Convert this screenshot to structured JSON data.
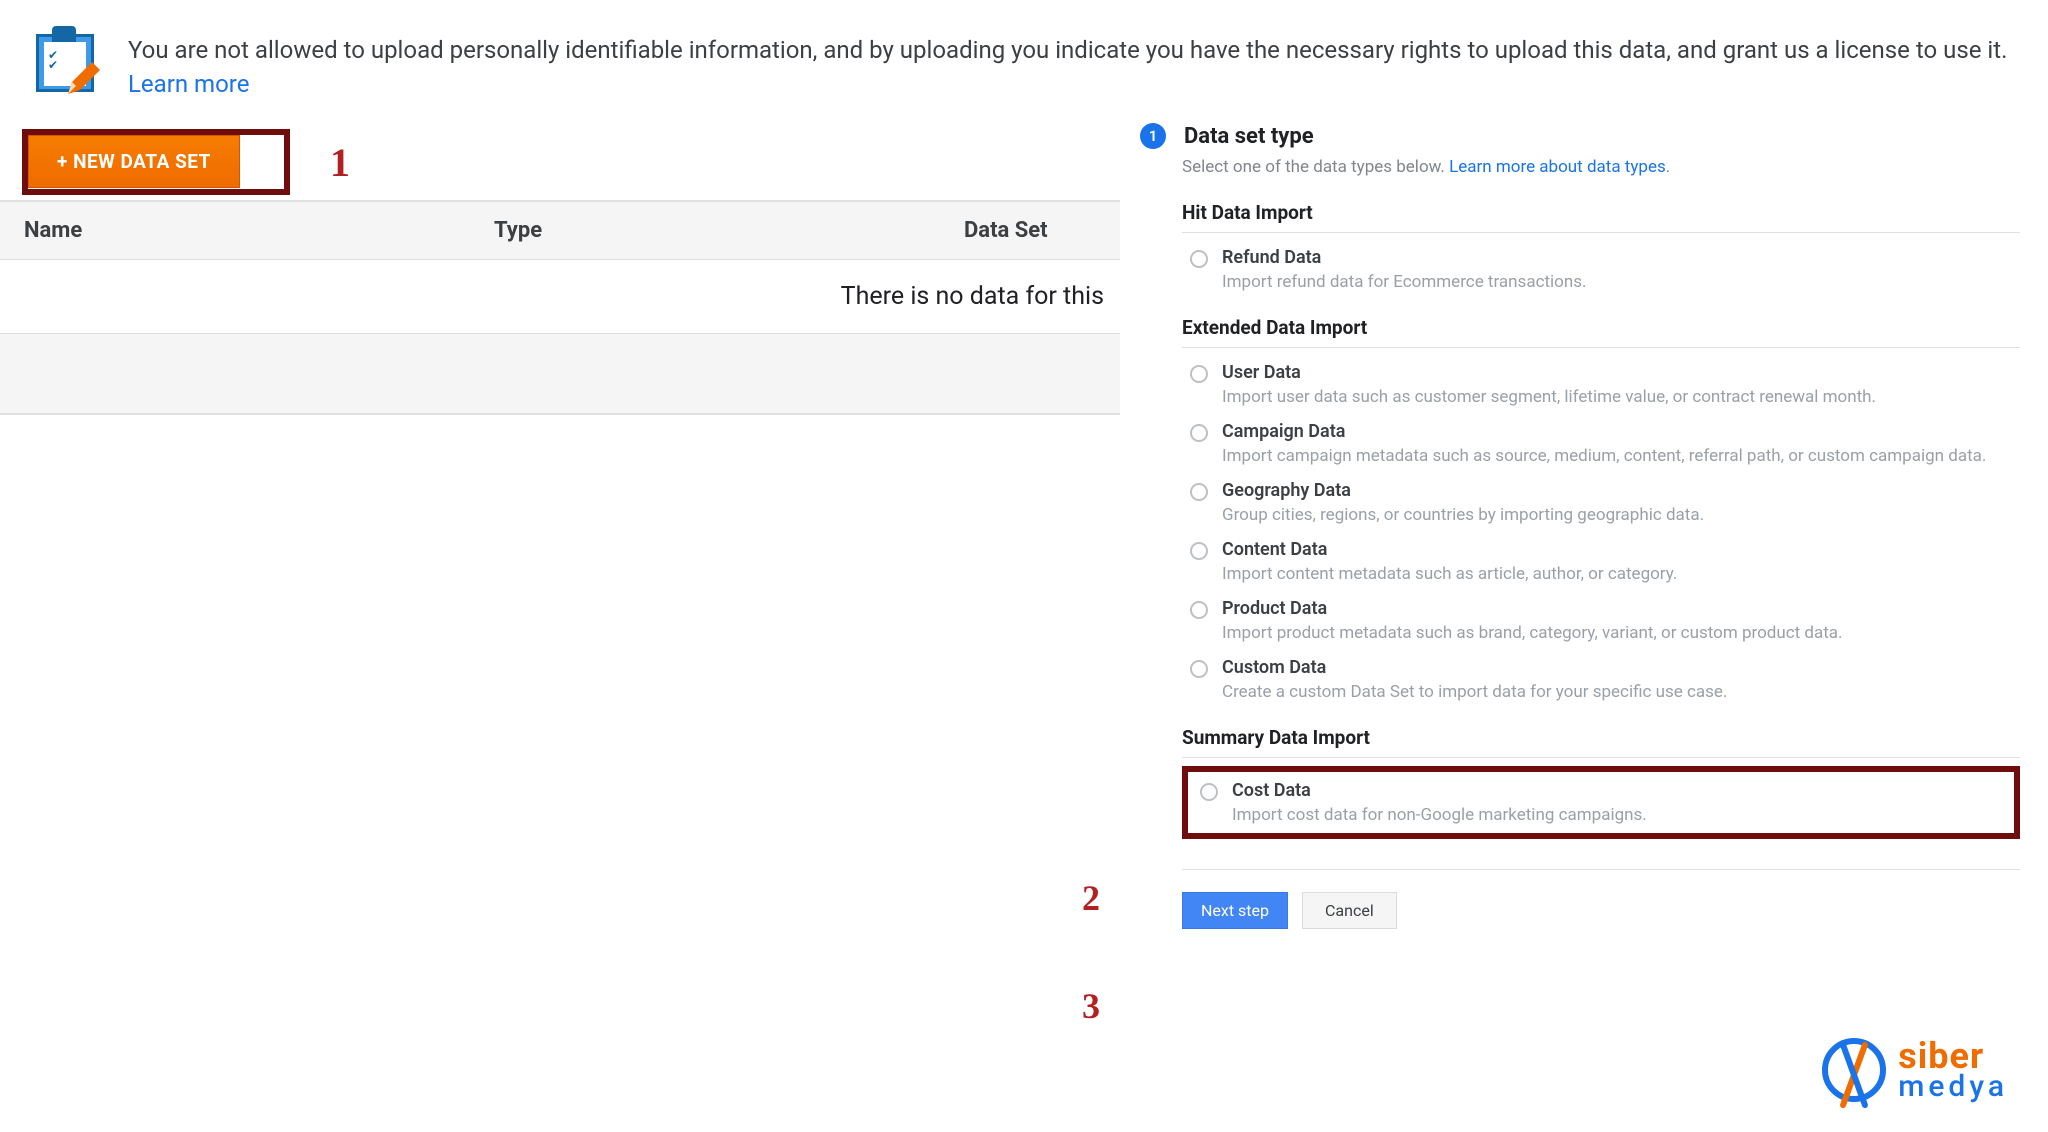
{
  "notice": {
    "text": "You are not allowed to upload personally identifiable information, and by uploading you indicate you have the necessary rights to upload this data, and grant us a license to use it. ",
    "link": "Learn more"
  },
  "left": {
    "new_button": "+ NEW DATA SET",
    "columns": {
      "name": "Name",
      "type": "Type",
      "id": "Data Set"
    },
    "empty": "There is no data for this"
  },
  "right": {
    "step_number": "1",
    "step_title": "Data set type",
    "step_sub_pre": "Select one of the data types below. ",
    "step_sub_link": "Learn more about data types",
    "sections": [
      {
        "title": "Hit Data Import",
        "options": [
          {
            "title": "Refund Data",
            "desc": "Import refund data for Ecommerce transactions."
          }
        ]
      },
      {
        "title": "Extended Data Import",
        "options": [
          {
            "title": "User Data",
            "desc": "Import user data such as customer segment, lifetime value, or contract renewal month."
          },
          {
            "title": "Campaign Data",
            "desc": "Import campaign metadata such as source, medium, content, referral path, or custom campaign data."
          },
          {
            "title": "Geography Data",
            "desc": "Group cities, regions, or countries by importing geographic data."
          },
          {
            "title": "Content Data",
            "desc": "Import content metadata such as article, author, or category."
          },
          {
            "title": "Product Data",
            "desc": "Import product metadata such as brand, category, variant, or custom product data."
          },
          {
            "title": "Custom Data",
            "desc": "Create a custom Data Set to import data for your specific use case."
          }
        ]
      },
      {
        "title": "Summary Data Import",
        "options": [
          {
            "title": "Cost Data",
            "desc": "Import cost data for non-Google marketing campaigns.",
            "highlighted": true
          }
        ]
      }
    ],
    "actions": {
      "next": "Next step",
      "cancel": "Cancel"
    }
  },
  "annotations": {
    "a1": "1",
    "a2": "2",
    "a3": "3"
  },
  "watermark": {
    "line1": "siber",
    "line2": "medya"
  }
}
